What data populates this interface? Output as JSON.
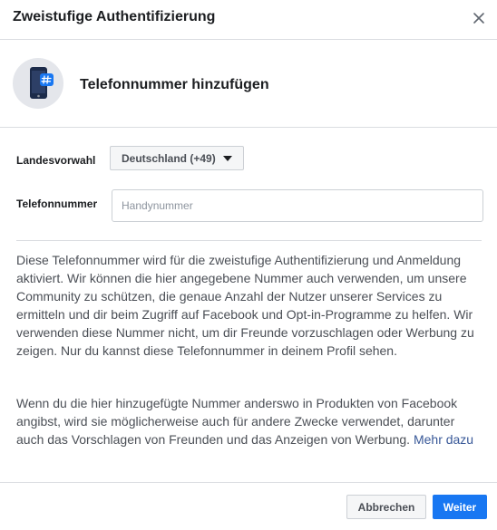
{
  "dialog": {
    "title": "Zweistufige Authentifizierung",
    "close_icon": "close-icon"
  },
  "hero": {
    "icon": "phone-hash-icon",
    "title": "Telefonnummer hinzufügen"
  },
  "form": {
    "country_label": "Landesvorwahl",
    "country_value": "Deutschland (+49)",
    "phone_label": "Telefonnummer",
    "phone_placeholder": "Handynummer",
    "phone_value": ""
  },
  "info": {
    "paragraph1": "Diese Telefonnummer wird für die zweistufige Authentifizierung und Anmeldung aktiviert. Wir können die hier angegebene Nummer auch verwenden, um unsere Community zu schützen, die genaue Anzahl der Nutzer unserer Services zu ermitteln und dir beim Zugriff auf Facebook und Opt-in-Programme zu helfen. Wir verwenden diese Nummer nicht, um dir Freunde vorzuschlagen oder Werbung zu zeigen. Nur du kannst diese Telefonnummer in deinem Profil sehen.",
    "paragraph2": "Wenn du die hier hinzugefügte Nummer anderswo in Produkten von Facebook angibst, wird sie möglicherweise auch für andere Zwecke verwendet, darunter auch das Vorschlagen von Freunden und das Anzeigen von Werbung.",
    "more_link": "Mehr dazu"
  },
  "footer": {
    "cancel_label": "Abbrechen",
    "next_label": "Weiter"
  },
  "colors": {
    "primary": "#1877f2",
    "link": "#385898",
    "border": "#dadde1"
  }
}
